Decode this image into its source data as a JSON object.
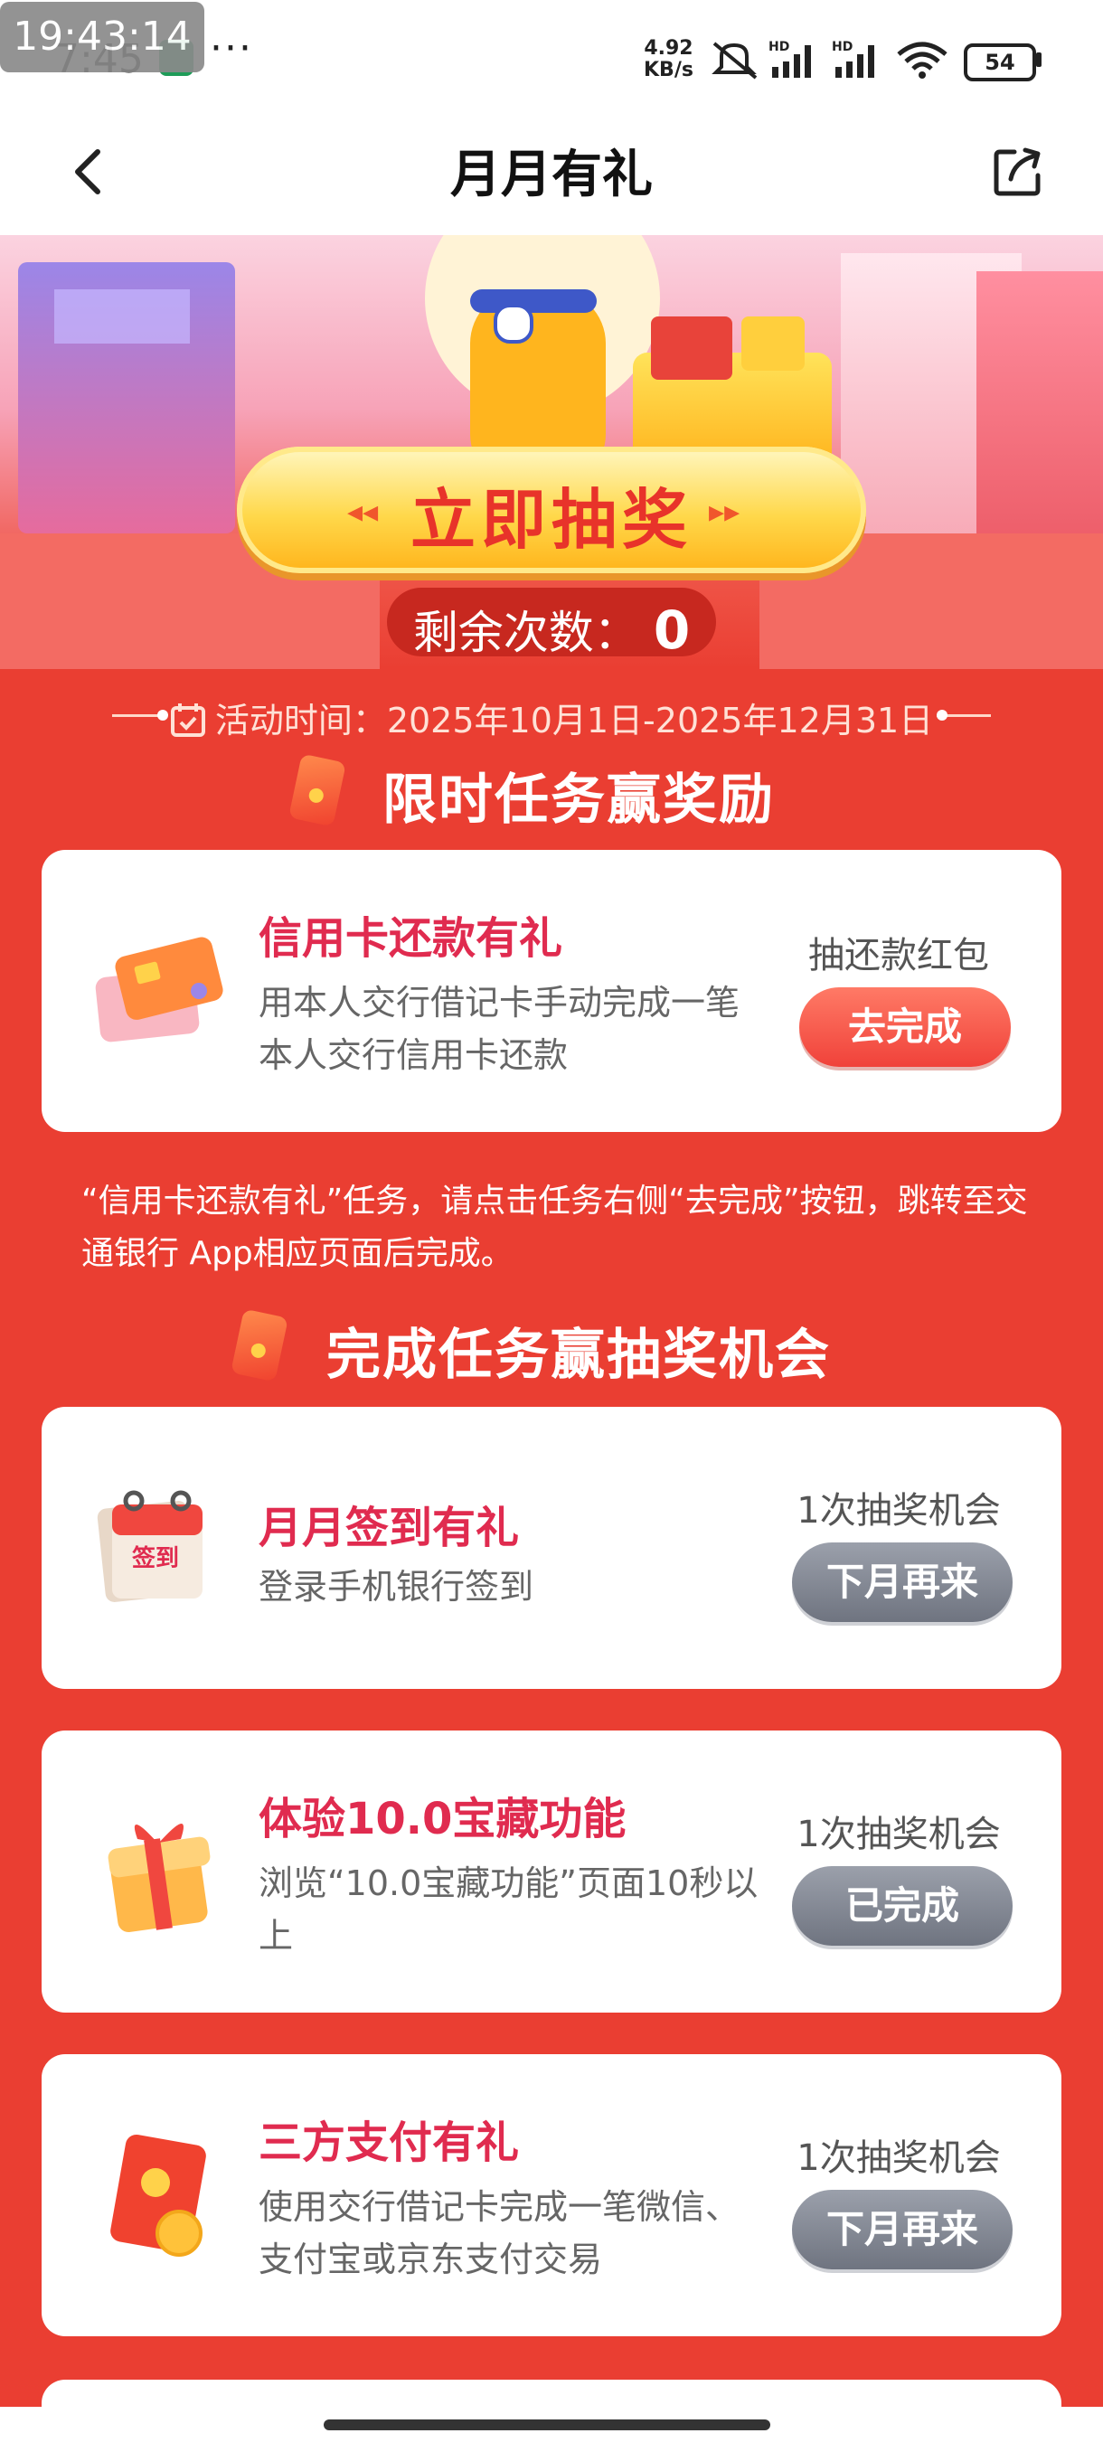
{
  "status_bar": {
    "time_overlay": "19:43:14",
    "time": "7:45",
    "more": "···",
    "net_speed_value": "4.92",
    "net_speed_unit": "KB/s",
    "battery": "54"
  },
  "nav": {
    "title": "月月有礼"
  },
  "banner": {
    "draw_button": "立即抽奖",
    "remaining_label": "剩余次数：",
    "remaining_count": "0"
  },
  "activity": {
    "time": "活动时间：2025年10月1日-2025年12月31日"
  },
  "section1": {
    "heading": "限时任务赢奖励",
    "tasks": [
      {
        "title": "信用卡还款有礼",
        "desc": "用本人交行借记卡手动完成一笔本人交行信用卡还款",
        "reward": "抽还款红包",
        "button": "去完成",
        "icon": "credit-card-icon"
      }
    ],
    "note": "“信用卡还款有礼”任务，请点击任务右侧“去完成”按钮，跳转至交通银行 App相应页面后完成。"
  },
  "section2": {
    "heading": "完成任务赢抽奖机会",
    "tasks": [
      {
        "title": "月月签到有礼",
        "desc": "登录手机银行签到",
        "reward": "1次抽奖机会",
        "button": "下月再来",
        "icon": "calendar-signin-icon",
        "icon_text": "签到"
      },
      {
        "title": "体验10.0宝藏功能",
        "desc": "浏览“10.0宝藏功能”页面10秒以上",
        "reward": "1次抽奖机会",
        "button": "已完成",
        "icon": "gift-box-icon"
      },
      {
        "title": "三方支付有礼",
        "desc": "使用交行借记卡完成一笔微信、支付宝或京东支付交易",
        "reward": "1次抽奖机会",
        "button": "下月再来",
        "icon": "red-envelope-icon"
      }
    ]
  },
  "colors": {
    "page_bg": "#ea3e32",
    "title_red": "#e02b4f",
    "button_red": "#f0423a",
    "button_gray": "#7d828d",
    "gold": "#ffd84a"
  }
}
